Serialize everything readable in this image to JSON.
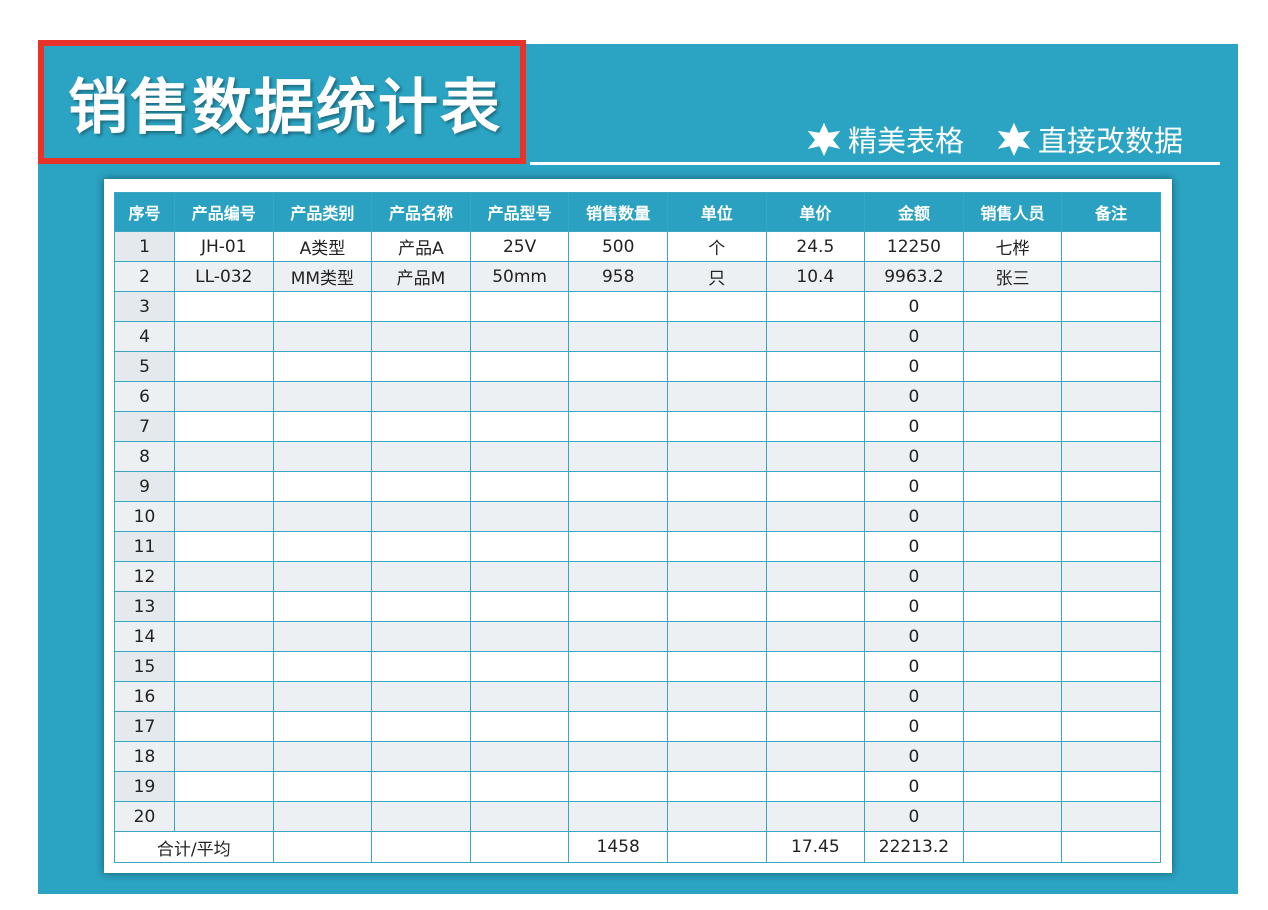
{
  "title": "销售数据统计表",
  "taglines": [
    "精美表格",
    "直接改数据"
  ],
  "colors": {
    "panel": "#2ba3c2",
    "title_border": "#e8332b",
    "header_bg": "#2aa1c0",
    "grid_line": "#3aa6c1",
    "stripe": "#edf0f2"
  },
  "icons": [
    "star-icon"
  ],
  "table": {
    "columns": [
      "序号",
      "产品编号",
      "产品类别",
      "产品名称",
      "产品型号",
      "销售数量",
      "单位",
      "单价",
      "金额",
      "销售人员",
      "备注"
    ],
    "rows": [
      [
        "1",
        "JH-01",
        "A类型",
        "产品A",
        "25V",
        "500",
        "个",
        "24.5",
        "12250",
        "七桦",
        ""
      ],
      [
        "2",
        "LL-032",
        "MM类型",
        "产品M",
        "50mm",
        "958",
        "只",
        "10.4",
        "9963.2",
        "张三",
        ""
      ],
      [
        "3",
        "",
        "",
        "",
        "",
        "",
        "",
        "",
        "0",
        "",
        ""
      ],
      [
        "4",
        "",
        "",
        "",
        "",
        "",
        "",
        "",
        "0",
        "",
        ""
      ],
      [
        "5",
        "",
        "",
        "",
        "",
        "",
        "",
        "",
        "0",
        "",
        ""
      ],
      [
        "6",
        "",
        "",
        "",
        "",
        "",
        "",
        "",
        "0",
        "",
        ""
      ],
      [
        "7",
        "",
        "",
        "",
        "",
        "",
        "",
        "",
        "0",
        "",
        ""
      ],
      [
        "8",
        "",
        "",
        "",
        "",
        "",
        "",
        "",
        "0",
        "",
        ""
      ],
      [
        "9",
        "",
        "",
        "",
        "",
        "",
        "",
        "",
        "0",
        "",
        ""
      ],
      [
        "10",
        "",
        "",
        "",
        "",
        "",
        "",
        "",
        "0",
        "",
        ""
      ],
      [
        "11",
        "",
        "",
        "",
        "",
        "",
        "",
        "",
        "0",
        "",
        ""
      ],
      [
        "12",
        "",
        "",
        "",
        "",
        "",
        "",
        "",
        "0",
        "",
        ""
      ],
      [
        "13",
        "",
        "",
        "",
        "",
        "",
        "",
        "",
        "0",
        "",
        ""
      ],
      [
        "14",
        "",
        "",
        "",
        "",
        "",
        "",
        "",
        "0",
        "",
        ""
      ],
      [
        "15",
        "",
        "",
        "",
        "",
        "",
        "",
        "",
        "0",
        "",
        ""
      ],
      [
        "16",
        "",
        "",
        "",
        "",
        "",
        "",
        "",
        "0",
        "",
        ""
      ],
      [
        "17",
        "",
        "",
        "",
        "",
        "",
        "",
        "",
        "0",
        "",
        ""
      ],
      [
        "18",
        "",
        "",
        "",
        "",
        "",
        "",
        "",
        "0",
        "",
        ""
      ],
      [
        "19",
        "",
        "",
        "",
        "",
        "",
        "",
        "",
        "0",
        "",
        ""
      ],
      [
        "20",
        "",
        "",
        "",
        "",
        "",
        "",
        "",
        "0",
        "",
        ""
      ]
    ],
    "total_label": "合计/平均",
    "totals": {
      "quantity": "1458",
      "unit_price_avg": "17.45",
      "amount": "22213.2"
    }
  }
}
